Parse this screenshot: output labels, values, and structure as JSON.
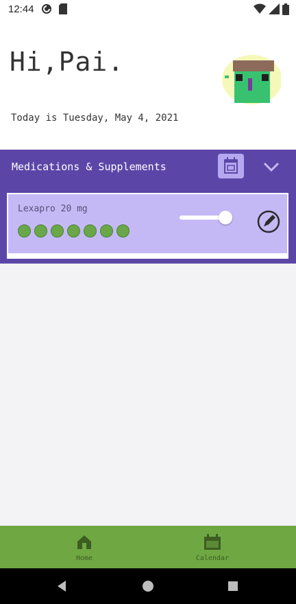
{
  "status_bar": {
    "time": "12:44",
    "icons": [
      "sync-icon",
      "sd-card-icon",
      "wifi-icon",
      "signal-icon",
      "battery-icon"
    ]
  },
  "header": {
    "greeting": "Hi,Pai.",
    "date_line": "Today is Tuesday, May 4, 2021"
  },
  "medications_panel": {
    "title": "Medications & Supplements",
    "calendar_icon": "calendar-icon",
    "chevron_icon": "chevron-down-icon",
    "accent_color": "#5b46a8",
    "card_color": "#c5b9f5",
    "items": [
      {
        "name": "Lexapro 20 mg",
        "dose_count": 7,
        "dose_color": "#6aa74a",
        "toggle_on": true
      }
    ]
  },
  "bottom_nav": {
    "color": "#6fa843",
    "items": [
      {
        "label": "Home",
        "icon": "home-icon"
      },
      {
        "label": "Calendar",
        "icon": "calendar-icon"
      }
    ]
  },
  "system_nav": {
    "buttons": [
      "back-icon",
      "home-circle-icon",
      "recents-icon"
    ]
  }
}
